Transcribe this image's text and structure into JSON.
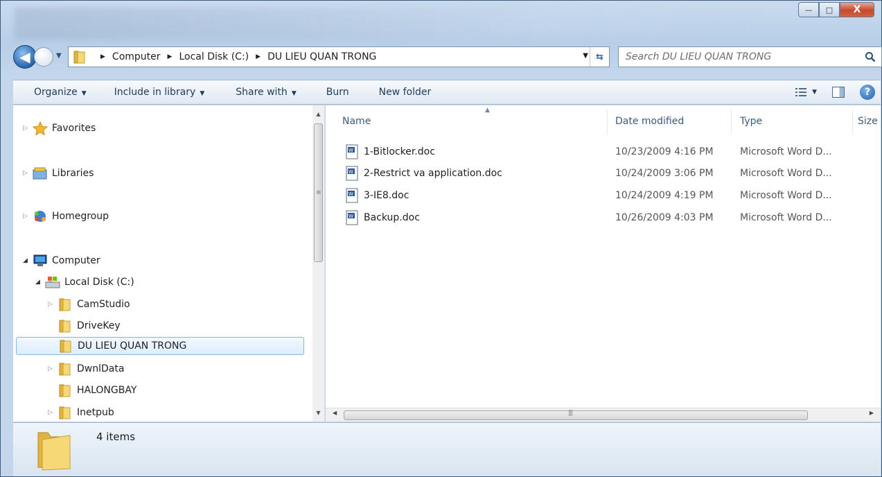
{
  "window": {
    "controls": {
      "minimize": "—",
      "maximize": "□",
      "close": "X"
    }
  },
  "navigation": {
    "breadcrumbs": [
      "Computer",
      "Local Disk (C:)",
      "DU LIEU QUAN TRONG"
    ],
    "search_placeholder": "Search DU LIEU QUAN TRONG"
  },
  "toolbar": {
    "organize": "Organize",
    "include_in_library": "Include in library",
    "share_with": "Share with",
    "burn": "Burn",
    "new_folder": "New folder"
  },
  "nav_pane": {
    "favorites": "Favorites",
    "libraries": "Libraries",
    "homegroup": "Homegroup",
    "computer": "Computer",
    "local_disk": "Local Disk (C:)",
    "folders": [
      "CamStudio",
      "DriveKey",
      "DU LIEU QUAN TRONG",
      "DwnlData",
      "HALONGBAY",
      "Inetpub"
    ]
  },
  "content": {
    "columns": {
      "name": "Name",
      "date_modified": "Date modified",
      "type": "Type",
      "size": "Size"
    },
    "files": [
      {
        "name": "1-Bitlocker.doc",
        "date": "10/23/2009 4:16 PM",
        "type": "Microsoft Word D..."
      },
      {
        "name": "2-Restrict va application.doc",
        "date": "10/24/2009 3:06 PM",
        "type": "Microsoft Word D..."
      },
      {
        "name": "3-IE8.doc",
        "date": "10/24/2009 4:19 PM",
        "type": "Microsoft Word D..."
      },
      {
        "name": "Backup.doc",
        "date": "10/26/2009 4:03 PM",
        "type": "Microsoft Word D..."
      }
    ]
  },
  "details": {
    "item_count": "4 items"
  }
}
